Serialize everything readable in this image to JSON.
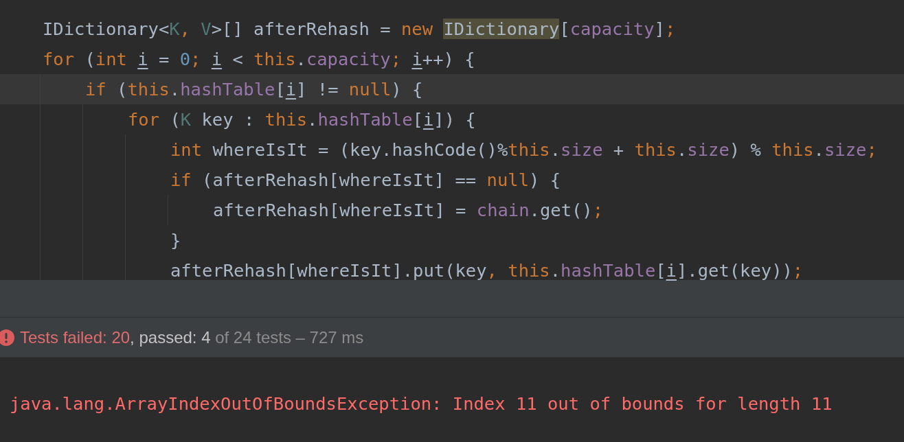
{
  "editor": {
    "lines": [
      {
        "selected": false,
        "tokens": [
          {
            "kind": "plain",
            "text": "IDictionary<"
          },
          {
            "kind": "typeparam",
            "text": "K"
          },
          {
            "kind": "keyword",
            "text": ", "
          },
          {
            "kind": "typeparam",
            "text": "V"
          },
          {
            "kind": "plain",
            "text": ">[] afterRehash = "
          },
          {
            "kind": "keyword",
            "text": "new "
          },
          {
            "kind": "usage",
            "text": "IDictionary"
          },
          {
            "kind": "plain",
            "text": "["
          },
          {
            "kind": "field",
            "text": "capacity"
          },
          {
            "kind": "plain",
            "text": "]"
          },
          {
            "kind": "keyword",
            "text": ";"
          }
        ]
      },
      {
        "selected": false,
        "tokens": [
          {
            "kind": "keyword",
            "text": "for "
          },
          {
            "kind": "plain",
            "text": "("
          },
          {
            "kind": "keyword",
            "text": "int "
          },
          {
            "kind": "var",
            "text": "i"
          },
          {
            "kind": "plain",
            "text": " = "
          },
          {
            "kind": "number",
            "text": "0"
          },
          {
            "kind": "keyword",
            "text": "; "
          },
          {
            "kind": "var",
            "text": "i"
          },
          {
            "kind": "plain",
            "text": " < "
          },
          {
            "kind": "keyword",
            "text": "this"
          },
          {
            "kind": "plain",
            "text": "."
          },
          {
            "kind": "field",
            "text": "capacity"
          },
          {
            "kind": "keyword",
            "text": "; "
          },
          {
            "kind": "var",
            "text": "i"
          },
          {
            "kind": "plain",
            "text": "++) {"
          }
        ],
        "children": [
          {
            "selected": true,
            "tokens": [
              {
                "kind": "keyword",
                "text": "if "
              },
              {
                "kind": "plain",
                "text": "("
              },
              {
                "kind": "keyword",
                "text": "this"
              },
              {
                "kind": "plain",
                "text": "."
              },
              {
                "kind": "field",
                "text": "hashTable"
              },
              {
                "kind": "plain",
                "text": "["
              },
              {
                "kind": "var",
                "text": "i"
              },
              {
                "kind": "plain",
                "text": "] != "
              },
              {
                "kind": "keyword",
                "text": "null"
              },
              {
                "kind": "plain",
                "text": ") {"
              }
            ],
            "children": [
              {
                "selected": false,
                "tokens": [
                  {
                    "kind": "keyword",
                    "text": "for "
                  },
                  {
                    "kind": "plain",
                    "text": "("
                  },
                  {
                    "kind": "typeparam",
                    "text": "K"
                  },
                  {
                    "kind": "plain",
                    "text": " key : "
                  },
                  {
                    "kind": "keyword",
                    "text": "this"
                  },
                  {
                    "kind": "plain",
                    "text": "."
                  },
                  {
                    "kind": "field",
                    "text": "hashTable"
                  },
                  {
                    "kind": "plain",
                    "text": "["
                  },
                  {
                    "kind": "var",
                    "text": "i"
                  },
                  {
                    "kind": "plain",
                    "text": "]) {"
                  }
                ],
                "children": [
                  {
                    "selected": false,
                    "tokens": [
                      {
                        "kind": "keyword",
                        "text": "int "
                      },
                      {
                        "kind": "plain",
                        "text": "whereIsIt = (key.hashCode()%"
                      },
                      {
                        "kind": "keyword",
                        "text": "this"
                      },
                      {
                        "kind": "plain",
                        "text": "."
                      },
                      {
                        "kind": "field",
                        "text": "size"
                      },
                      {
                        "kind": "plain",
                        "text": " + "
                      },
                      {
                        "kind": "keyword",
                        "text": "this"
                      },
                      {
                        "kind": "plain",
                        "text": "."
                      },
                      {
                        "kind": "field",
                        "text": "size"
                      },
                      {
                        "kind": "plain",
                        "text": ") % "
                      },
                      {
                        "kind": "keyword",
                        "text": "this"
                      },
                      {
                        "kind": "plain",
                        "text": "."
                      },
                      {
                        "kind": "field",
                        "text": "size"
                      },
                      {
                        "kind": "keyword",
                        "text": ";"
                      }
                    ]
                  },
                  {
                    "selected": false,
                    "tokens": [
                      {
                        "kind": "keyword",
                        "text": "if "
                      },
                      {
                        "kind": "plain",
                        "text": "(afterRehash[whereIsIt] == "
                      },
                      {
                        "kind": "keyword",
                        "text": "null"
                      },
                      {
                        "kind": "plain",
                        "text": ") {"
                      }
                    ],
                    "children": [
                      {
                        "selected": false,
                        "tokens": [
                          {
                            "kind": "plain",
                            "text": "afterRehash[whereIsIt] = "
                          },
                          {
                            "kind": "field",
                            "text": "chain"
                          },
                          {
                            "kind": "plain",
                            "text": ".get()"
                          },
                          {
                            "kind": "keyword",
                            "text": ";"
                          }
                        ]
                      }
                    ]
                  },
                  {
                    "selected": false,
                    "tokens": [
                      {
                        "kind": "plain",
                        "text": "}"
                      }
                    ]
                  },
                  {
                    "selected": false,
                    "tokens": [
                      {
                        "kind": "plain",
                        "text": "afterRehash[whereIsIt].put(key"
                      },
                      {
                        "kind": "keyword",
                        "text": ", "
                      },
                      {
                        "kind": "keyword",
                        "text": "this"
                      },
                      {
                        "kind": "plain",
                        "text": "."
                      },
                      {
                        "kind": "field",
                        "text": "hashTable"
                      },
                      {
                        "kind": "plain",
                        "text": "["
                      },
                      {
                        "kind": "var",
                        "text": "i"
                      },
                      {
                        "kind": "plain",
                        "text": "].get(key))"
                      },
                      {
                        "kind": "keyword",
                        "text": ";"
                      }
                    ]
                  }
                ]
              }
            ]
          }
        ]
      }
    ]
  },
  "test_status": {
    "segments": [
      {
        "kind": "failed",
        "text": "Tests failed: 20"
      },
      {
        "kind": "passed",
        "text": ", passed: 4"
      },
      {
        "kind": "summary",
        "text": " of 24 tests – 727 ms"
      }
    ]
  },
  "console": {
    "error": "java.lang.ArrayIndexOutOfBoundsException: Index 11 out of bounds for length 11"
  }
}
